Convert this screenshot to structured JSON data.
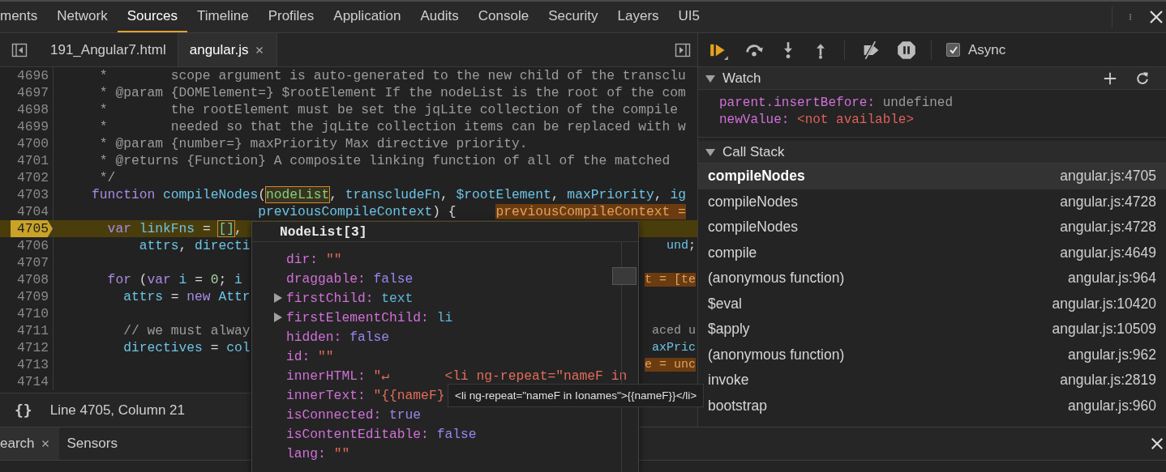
{
  "tabs": [
    {
      "label": "ments",
      "selected": false
    },
    {
      "label": "Network",
      "selected": false
    },
    {
      "label": "Sources",
      "selected": true
    },
    {
      "label": "Timeline",
      "selected": false
    },
    {
      "label": "Profiles",
      "selected": false
    },
    {
      "label": "Application",
      "selected": false
    },
    {
      "label": "Audits",
      "selected": false
    },
    {
      "label": "Console",
      "selected": false
    },
    {
      "label": "Security",
      "selected": false
    },
    {
      "label": "Layers",
      "selected": false
    },
    {
      "label": "UI5",
      "selected": false
    }
  ],
  "file_tabs": [
    {
      "label": "191_Angular7.html",
      "selected": false,
      "closable": false
    },
    {
      "label": "angular.js",
      "selected": true,
      "closable": true
    }
  ],
  "code": [
    {
      "number": "4696",
      "paused": false,
      "segments": [
        {
          "kind": "comment",
          "text": "     *        scope argument is auto-generated to the new child of the transclu"
        }
      ]
    },
    {
      "number": "4697",
      "paused": false,
      "segments": [
        {
          "kind": "comment",
          "text": "     * @param {DOMElement=} $rootElement If the nodeList is the root of the com"
        }
      ]
    },
    {
      "number": "4698",
      "paused": false,
      "segments": [
        {
          "kind": "comment",
          "text": "     *        the rootElement must be set the jqLite collection of the compile"
        }
      ]
    },
    {
      "number": "4699",
      "paused": false,
      "segments": [
        {
          "kind": "comment",
          "text": "     *        needed so that the jqLite collection items can be replaced with w"
        }
      ]
    },
    {
      "number": "4700",
      "paused": false,
      "segments": [
        {
          "kind": "comment",
          "text": "     * @param {number=} maxPriority Max directive priority."
        }
      ]
    },
    {
      "number": "4701",
      "paused": false,
      "segments": [
        {
          "kind": "comment",
          "text": "     * @returns {Function} A composite linking function of all of the matched"
        }
      ]
    },
    {
      "number": "4702",
      "paused": false,
      "segments": [
        {
          "kind": "comment",
          "text": "     */"
        }
      ]
    },
    {
      "number": "4703",
      "paused": false,
      "segments": [
        {
          "kind": "keyword",
          "text": "    function "
        },
        {
          "kind": "name",
          "text": "compileNodes"
        },
        {
          "kind": "plain",
          "text": "("
        },
        {
          "kind": "match",
          "text": "nodeList"
        },
        {
          "kind": "plain",
          "text": ", "
        },
        {
          "kind": "name",
          "text": "transcludeFn"
        },
        {
          "kind": "plain",
          "text": ", "
        },
        {
          "kind": "name",
          "text": "$rootElement"
        },
        {
          "kind": "plain",
          "text": ", "
        },
        {
          "kind": "name",
          "text": "maxPriority"
        },
        {
          "kind": "plain",
          "text": ", "
        },
        {
          "kind": "name",
          "text": "ig"
        }
      ]
    },
    {
      "number": "4704",
      "paused": false,
      "segments": [
        {
          "kind": "name",
          "text": "                         previousCompileContext"
        },
        {
          "kind": "plain",
          "text": ") {     "
        },
        {
          "kind": "value",
          "text": "previousCompileContext ="
        }
      ]
    },
    {
      "number": "4705",
      "paused": true,
      "segments": [
        {
          "kind": "keyword",
          "text": "      var "
        },
        {
          "kind": "name",
          "text": "linkFns"
        },
        {
          "kind": "plain",
          "text": " = "
        },
        {
          "kind": "match",
          "text": "[]"
        },
        {
          "kind": "plain",
          "text": ","
        }
      ]
    },
    {
      "number": "4706",
      "paused": false,
      "segments": [
        {
          "kind": "name",
          "text": "          attrs"
        },
        {
          "kind": "plain",
          "text": ", "
        },
        {
          "kind": "name",
          "text": "directi"
        }
      ],
      "tail": [
        {
          "kind": "name",
          "text": "und"
        },
        {
          "kind": "plain",
          "text": ";"
        }
      ]
    },
    {
      "number": "4707",
      "paused": false
    },
    {
      "number": "4708",
      "paused": false,
      "segments": [
        {
          "kind": "keyword",
          "text": "      for"
        },
        {
          "kind": "plain",
          "text": " ("
        },
        {
          "kind": "keyword",
          "text": "var "
        },
        {
          "kind": "name",
          "text": "i"
        },
        {
          "kind": "plain",
          "text": " = "
        },
        {
          "kind": "number",
          "text": "0"
        },
        {
          "kind": "plain",
          "text": "; "
        },
        {
          "kind": "name",
          "text": "i"
        }
      ],
      "tail": [
        {
          "kind": "value",
          "text": "t = [te"
        }
      ]
    },
    {
      "number": "4709",
      "paused": false,
      "segments": [
        {
          "kind": "name",
          "text": "        attrs"
        },
        {
          "kind": "plain",
          "text": " = "
        },
        {
          "kind": "keyword",
          "text": "new "
        },
        {
          "kind": "name",
          "text": "Attr"
        }
      ]
    },
    {
      "number": "4710",
      "paused": false
    },
    {
      "number": "4711",
      "paused": false,
      "segments": [
        {
          "kind": "comment",
          "text": "        // we must alway"
        }
      ],
      "tail": [
        {
          "kind": "comment",
          "text": "aced u"
        }
      ]
    },
    {
      "number": "4712",
      "paused": false,
      "segments": [
        {
          "kind": "name",
          "text": "        directives"
        },
        {
          "kind": "plain",
          "text": " = "
        },
        {
          "kind": "name",
          "text": "col"
        }
      ],
      "tail": [
        {
          "kind": "name",
          "text": "axPric"
        }
      ]
    },
    {
      "number": "4713",
      "paused": false,
      "tail": [
        {
          "kind": "value",
          "text": "e = unc"
        }
      ]
    },
    {
      "number": "4714",
      "paused": false
    }
  ],
  "status_bar": {
    "format_button": "{}",
    "position": "Line 4705, Column 21"
  },
  "drawer_tabs": [
    {
      "label": "earch",
      "selected": true,
      "closable": true
    },
    {
      "label": "Sensors",
      "selected": false,
      "closable": false
    }
  ],
  "popover": {
    "title": "NodeList[3]",
    "properties": [
      {
        "name": "dir:",
        "value": "\"\"",
        "kind": "string",
        "expandable": false
      },
      {
        "name": "draggable:",
        "value": "false",
        "kind": "bool",
        "expandable": false
      },
      {
        "name": "firstChild:",
        "value": "text",
        "kind": "node",
        "expandable": true
      },
      {
        "name": "firstElementChild:",
        "value": "li",
        "kind": "node",
        "expandable": true
      },
      {
        "name": "hidden:",
        "value": "false",
        "kind": "bool",
        "expandable": false
      },
      {
        "name": "id:",
        "value": "\"\"",
        "kind": "string",
        "expandable": false
      },
      {
        "name": "innerHTML:",
        "value": "\"↵       <li ng-repeat=\"nameF in",
        "kind": "string",
        "expandable": false
      },
      {
        "name": "innerText:",
        "value": "\"{{nameF}",
        "kind": "string",
        "expandable": false
      },
      {
        "name": "isConnected:",
        "value": "true",
        "kind": "bool",
        "expandable": false
      },
      {
        "name": "isContentEditable:",
        "value": "false",
        "kind": "bool",
        "expandable": false
      },
      {
        "name": "lang:",
        "value": "\"\"",
        "kind": "string",
        "expandable": false
      }
    ]
  },
  "tooltip": "<li ng-repeat=\"nameF in Ionames\">{{nameF}}</li>",
  "debugger": {
    "async": {
      "label": "Async",
      "checked": true
    }
  },
  "watch": {
    "title": "Watch",
    "expanded": true,
    "entries": [
      {
        "name": "parent.insertBefore:",
        "value": "undefined",
        "kind": "undefined"
      },
      {
        "name": "newValue:",
        "value": "<not available>",
        "kind": "unavailable"
      }
    ]
  },
  "call_stack": {
    "title": "Call Stack",
    "expanded": true,
    "frames": [
      {
        "name": "compileNodes",
        "location": "angular.js:4705",
        "selected": true
      },
      {
        "name": "compileNodes",
        "location": "angular.js:4728",
        "selected": false
      },
      {
        "name": "compileNodes",
        "location": "angular.js:4728",
        "selected": false
      },
      {
        "name": "compile",
        "location": "angular.js:4649",
        "selected": false
      },
      {
        "name": "(anonymous function)",
        "location": "angular.js:964",
        "selected": false
      },
      {
        "name": "$eval",
        "location": "angular.js:10420",
        "selected": false
      },
      {
        "name": "$apply",
        "location": "angular.js:10509",
        "selected": false
      },
      {
        "name": "(anonymous function)",
        "location": "angular.js:962",
        "selected": false
      },
      {
        "name": "invoke",
        "location": "angular.js:2819",
        "selected": false
      },
      {
        "name": "bootstrap",
        "location": "angular.js:960",
        "selected": false
      }
    ]
  }
}
